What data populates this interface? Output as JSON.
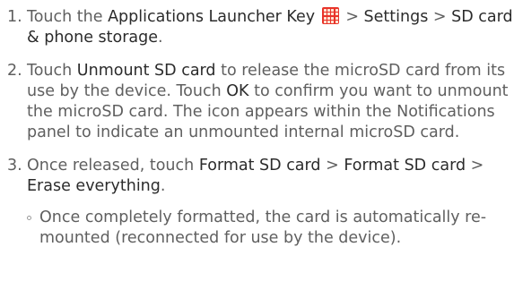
{
  "steps": [
    {
      "num": "1.",
      "before": "Touch the ",
      "hl1": "Applications Launcher Key",
      "icon": "applications-launcher-grid-icon",
      "mid": " > ",
      "hl2": "Settings",
      "sep": " > ",
      "hl3": "SD card & phone storage",
      "end": "."
    },
    {
      "num": "2.",
      "t1": "Touch ",
      "hl1": "Unmount SD card",
      "t2": " to release the microSD card from its use by the device. Touch ",
      "hl2": "OK",
      "t3": " to confirm you want to unmount the microSD card. The icon appears within the Notifications panel to indicate an unmounted internal microSD card."
    },
    {
      "num": "3.",
      "t1": "Once released, touch ",
      "hl1": "Format SD card",
      "sep1": " > ",
      "hl2": "Format SD card",
      "sep2": " > ",
      "hl3": "Erase everything",
      "end": "."
    }
  ],
  "sub_note": "Once completely formatted, the card is automatically re-mounted (reconnected for use by the device)."
}
